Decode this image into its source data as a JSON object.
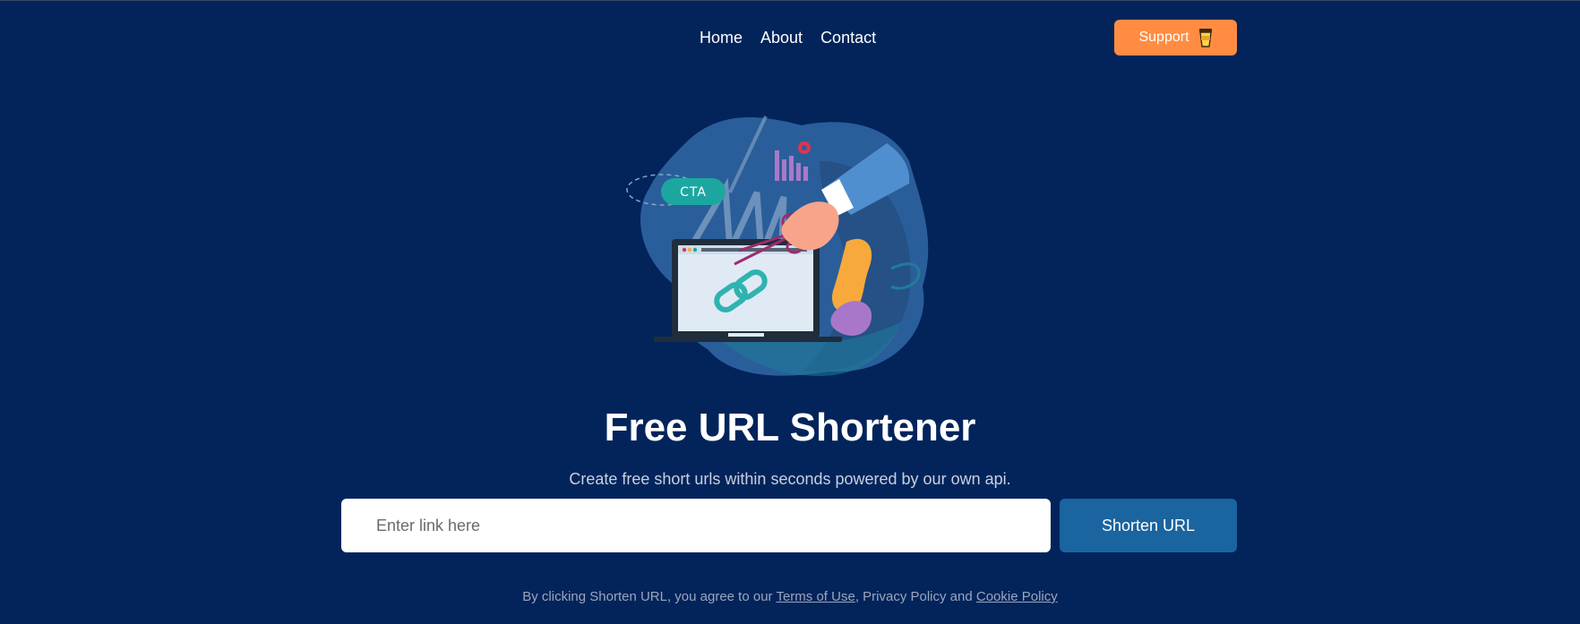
{
  "nav": {
    "links": [
      {
        "label": "Home"
      },
      {
        "label": "About"
      },
      {
        "label": "Contact"
      }
    ],
    "support_label": "Support"
  },
  "illustration": {
    "badge_text": "CTA",
    "icons": [
      "laptop-icon",
      "chain-link-icon",
      "scissors-icon",
      "hand-icon",
      "bar-chart-icon",
      "gear-icon"
    ]
  },
  "hero": {
    "title": "Free URL Shortener",
    "subtitle": "Create free short urls within seconds powered by our own api."
  },
  "form": {
    "input_placeholder": "Enter link here",
    "input_value": "",
    "button_label": "Shorten URL"
  },
  "legal": {
    "prefix": "By clicking Shorten URL, you agree to our ",
    "terms_label": "Terms of Use",
    "middle": ", Privacy Policy and ",
    "cookie_label": "Cookie Policy"
  },
  "colors": {
    "background": "#02245b",
    "support_button": "#ff8c42",
    "shorten_button": "#1a64a0",
    "input_background": "#ffffff"
  }
}
